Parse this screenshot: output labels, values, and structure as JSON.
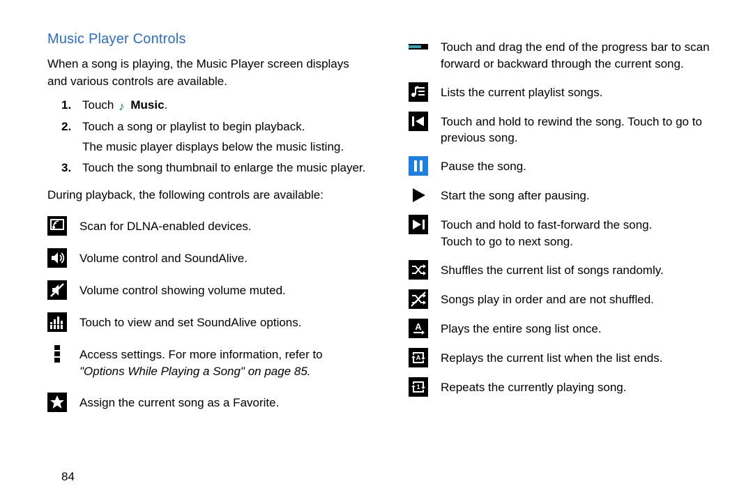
{
  "heading": "Music Player Controls",
  "intro": "When a song is playing, the Music Player screen displays and various controls are available.",
  "steps": {
    "s1": {
      "num": "1.",
      "pre": "Touch",
      "app": "Music",
      "post": "."
    },
    "s2": {
      "num": "2.",
      "line1": "Touch a song or playlist to begin playback.",
      "line2": "The music player displays below the music listing."
    },
    "s3": {
      "num": "3.",
      "line1": "Touch the song thumbnail to enlarge the music player."
    }
  },
  "during": "During playback, the following controls are available:",
  "left_icons": {
    "dlna": "Scan for DLNA-enabled devices.",
    "volume": "Volume control and SoundAlive.",
    "muted": "Volume control showing volume muted.",
    "eq": "Touch to view and set SoundAlive options.",
    "settings_a": "Access settings. For more information, refer to",
    "settings_b": "\"Options While Playing a Song\" on page 85.",
    "favorite": "Assign the current song as a Favorite."
  },
  "right_icons": {
    "progress": "Touch and drag the end of the progress bar to scan forward or backward through the current song.",
    "playlist": "Lists the current playlist songs.",
    "prev": "Touch and hold to rewind the song. Touch to go to previous song.",
    "pause": "Pause the song.",
    "play": "Start the song after pausing.",
    "next_a": "Touch and hold to fast-forward the song.",
    "next_b": "Touch to go to next song.",
    "shuffle_on": "Shuffles the current list of songs randomly.",
    "shuffle_off": "Songs play in order and are not shuffled.",
    "play_once": "Plays the entire song list once.",
    "repeat_all": "Replays the current list when the list ends.",
    "repeat_one": "Repeats the currently playing song."
  },
  "page_number": "84"
}
